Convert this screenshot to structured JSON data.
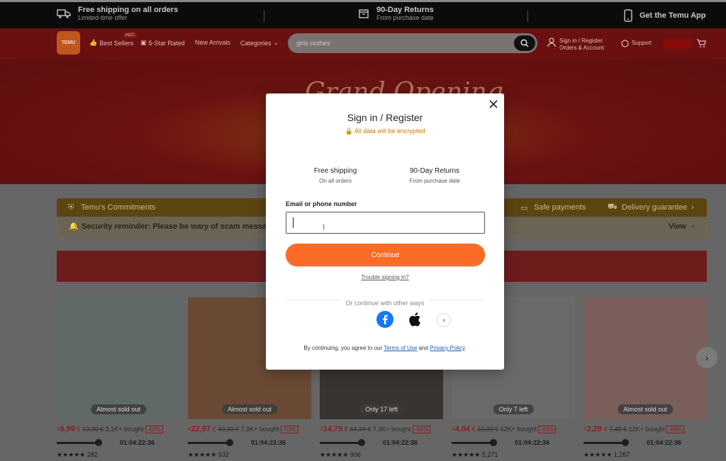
{
  "topbar": {
    "shipping_title": "Free shipping on all orders",
    "shipping_sub": "Limited-time offer",
    "returns_title": "90-Day Returns",
    "returns_sub": "From purchase date",
    "app_label": "Get the Temu App"
  },
  "header": {
    "logo_text": "TEMU",
    "nav": [
      "Best Sellers",
      "5-Star Rated",
      "New Arrivals",
      "Categories"
    ],
    "hot_badge": "HOT",
    "search_value": "girls clothes",
    "account_line1": "Sign in / Register",
    "account_line2": "Orders & Account",
    "support": "Support"
  },
  "banner": {
    "title": "Grand Opening"
  },
  "commitments": {
    "title": "Temu's Commitments",
    "safe_payments": "Safe payments",
    "delivery": "Delivery guarantee",
    "reminder": "Security reminder: Please be wary of scam messages",
    "view": "View"
  },
  "products": [
    {
      "tag": "Almost sold out",
      "currency": "₫",
      "price": "8,99",
      "unit": "€",
      "old": "23,99 €",
      "sold": "3,1K+ bought",
      "discount": "-62%",
      "timer": "01:04:22:36",
      "stars": "★★★★★",
      "reviews": "282"
    },
    {
      "tag": "Almost sold out",
      "currency": "₫",
      "price": "22,97",
      "unit": "€",
      "old": "49,49 €",
      "sold": "7,9K+ bought",
      "discount": "-53%",
      "timer": "01:04:22:36",
      "stars": "★★★★★",
      "reviews": "532"
    },
    {
      "tag": "Only 17 left",
      "currency": "₫",
      "price": "14,79",
      "unit": "€",
      "old": "44,39 €",
      "sold": "7,3K+ bought",
      "discount": "-66%",
      "timer": "01:04:22:36",
      "stars": "★★★★★",
      "reviews": "906"
    },
    {
      "tag": "Only 7 left",
      "currency": "₫",
      "price": "4,04",
      "unit": "€",
      "old": "10,99 €",
      "sold": "62K+ bought",
      "discount": "-63%",
      "timer": "01:04:22:36",
      "stars": "★★★★★",
      "reviews": "5,271"
    },
    {
      "tag": "Almost sold out",
      "currency": "₫",
      "price": "2,29",
      "unit": "€",
      "old": "7,49 €",
      "sold": "12K+ bought",
      "discount": "-69%",
      "timer": "01:04:22:36",
      "stars": "★★★★★",
      "reviews": "1,287"
    }
  ],
  "modal": {
    "title": "Sign in / Register",
    "encrypted": "All data will be encrypted",
    "feature1_title": "Free shipping",
    "feature1_sub": "On all orders",
    "feature2_title": "90-Day Returns",
    "feature2_sub": "From purchase date",
    "field_label": "Email or phone number",
    "field_value": "",
    "continue": "Continue",
    "trouble": "Trouble signing in?",
    "other_ways": "Or continue with other ways",
    "terms_prefix": "By continuing, you agree to our",
    "terms_link": "Terms of Use",
    "terms_and": "and",
    "privacy_link": "Privacy Policy",
    "terms_suffix": "."
  },
  "colors": {
    "accent": "#fb6b25",
    "encrypt": "#d07700",
    "link": "#1b5ca8"
  }
}
